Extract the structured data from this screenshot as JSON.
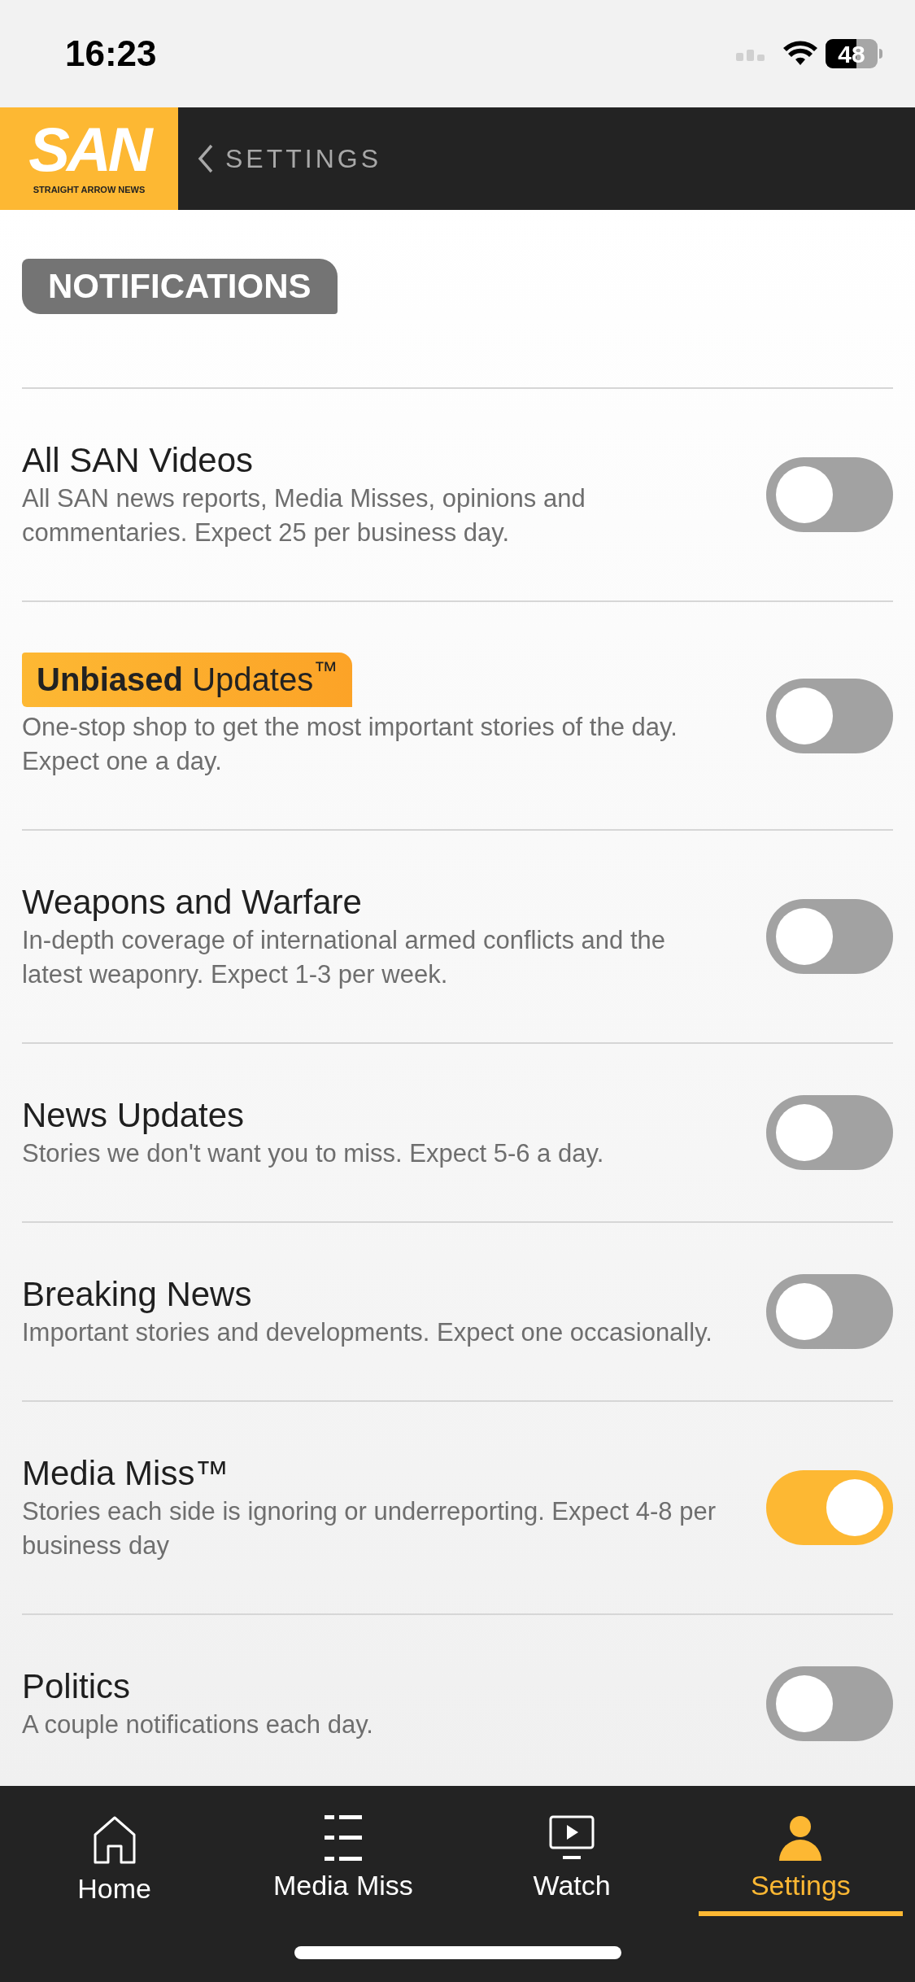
{
  "status_bar": {
    "time": "16:23",
    "battery": "48"
  },
  "header": {
    "logo": {
      "wordmark": "SAN",
      "tagline": "STRAIGHT ARROW NEWS"
    },
    "back_label": "SETTINGS"
  },
  "section_label": "NOTIFICATIONS",
  "notifications": [
    {
      "kind": "plain",
      "title": "All SAN Videos",
      "description": "All SAN news reports, Media Misses, opinions and commentaries. Expect 25 per business day.",
      "on": false
    },
    {
      "kind": "badge",
      "title": "**Unbiased** Updates$^{™}$",
      "description": "One-stop shop to get the most important stories of the day. Expect one a day.",
      "on": false
    },
    {
      "kind": "plain",
      "title": "Weapons and Warfare",
      "description": "In-depth coverage of international armed conflicts and the latest weaponry. Expect 1-3 per week.",
      "on": false
    },
    {
      "kind": "plain",
      "title": "News Updates",
      "description": "Stories we don't want you to miss. Expect 5-6 a day.",
      "on": false
    },
    {
      "kind": "plain",
      "title": "Breaking News",
      "description": "Important stories and developments. Expect one occasionally.",
      "on": false
    },
    {
      "kind": "plain",
      "title": "Media Miss™",
      "description": "Stories each side is ignoring or underreporting. Expect 4-8 per business day",
      "on": true
    },
    {
      "kind": "plain",
      "title": "Politics",
      "description": "A couple notifications each day.",
      "on": false
    }
  ],
  "tab_bar": [
    {
      "kind": "home",
      "label": "Home",
      "selected": false
    },
    {
      "kind": "list",
      "label": "Media Miss",
      "selected": false
    },
    {
      "kind": "watch",
      "label": "Watch",
      "selected": false
    },
    {
      "kind": "person",
      "label": "Settings",
      "selected": true
    }
  ]
}
